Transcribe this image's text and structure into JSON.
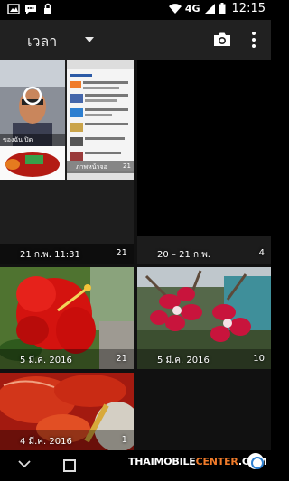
{
  "status_bar": {
    "network": "4G",
    "time": "12:15"
  },
  "app_bar": {
    "view_label": "เวลา",
    "icons": [
      "camera-icon",
      "overflow-menu-icon",
      "chevron-down-icon"
    ]
  },
  "albums": [
    {
      "label": "21 ก.พ. 11:31",
      "count": "21"
    },
    {
      "label": "20 – 21 ก.พ.",
      "count": "4"
    },
    {
      "label": "5 มี.ค. 2016",
      "count": "21"
    },
    {
      "label": "5 มี.ค. 2016",
      "count": "10"
    },
    {
      "label": "4 มี.ค. 2016",
      "count": "1"
    }
  ],
  "thumbnails": {
    "selfie_caption": "ของฉัน ปิด",
    "screenshot_caption": "ภาพหน้าจอ",
    "screenshot_count": "21"
  },
  "watermark": {
    "thai": "THAIMOBILE",
    "center": "CENTER",
    "suffix": ".COM"
  },
  "colors": {
    "app_bar": "#212121",
    "background": "#111111",
    "accent_orange": "#f07b2a"
  }
}
